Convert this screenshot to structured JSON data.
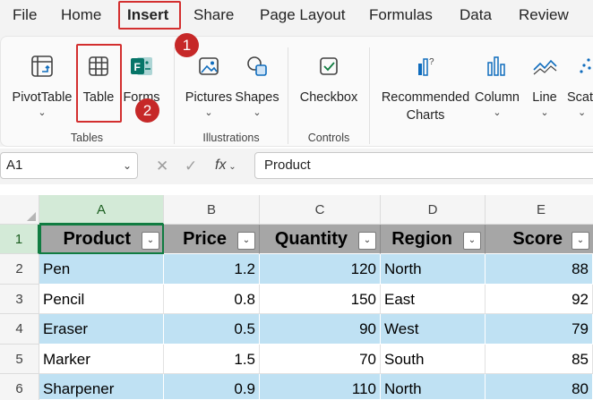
{
  "menu": {
    "tabs": [
      {
        "label": "File"
      },
      {
        "label": "Home"
      },
      {
        "label": "Insert",
        "active": true
      },
      {
        "label": "Share"
      },
      {
        "label": "Page Layout"
      },
      {
        "label": "Formulas"
      },
      {
        "label": "Data"
      },
      {
        "label": "Review"
      }
    ]
  },
  "annotations": {
    "badge1": "1",
    "badge2": "2",
    "highlight_color": "#d32f2f"
  },
  "ribbon": {
    "groups": {
      "tables": "Tables",
      "illustrations": "Illustrations",
      "controls": "Controls"
    },
    "buttons": {
      "pivottable": "PivotTable",
      "table": "Table",
      "forms": "Forms",
      "pictures": "Pictures",
      "shapes": "Shapes",
      "checkbox": "Checkbox",
      "recommended_line1": "Recommended",
      "recommended_line2": "Charts",
      "column": "Column",
      "line": "Line",
      "scatter": "Scat"
    },
    "chevron": "⌄"
  },
  "formula_bar": {
    "name_box": "A1",
    "formula": "Product",
    "fx_label": "fx"
  },
  "grid": {
    "columns": [
      "A",
      "B",
      "C",
      "D",
      "E"
    ],
    "rows": [
      "1",
      "2",
      "3",
      "4",
      "5",
      "6"
    ],
    "selected_cell": "A1",
    "header": [
      "Product",
      "Price",
      "Quantity",
      "Region",
      "Score"
    ],
    "data": [
      [
        "Pen",
        "1.2",
        "120",
        "North",
        "88"
      ],
      [
        "Pencil",
        "0.8",
        "150",
        "East",
        "92"
      ],
      [
        "Eraser",
        "0.5",
        "90",
        "West",
        "79"
      ],
      [
        "Marker",
        "1.5",
        "70",
        "South",
        "85"
      ],
      [
        "Sharpener",
        "0.9",
        "110",
        "North",
        "80"
      ]
    ],
    "colors": {
      "header_fill": "#a6a6a6",
      "band_fill": "#bfe1f3",
      "selection": "#107c41"
    }
  }
}
